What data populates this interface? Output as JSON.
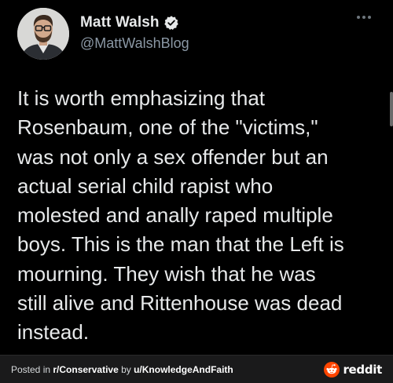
{
  "tweet": {
    "display_name": "Matt Walsh",
    "handle": "@MattWalshBlog",
    "text": "It is worth emphasizing that\nRosenbaum, one of the \"victims,\"\nwas not only a sex offender but an\nactual serial child rapist who\nmolested and anally raped multiple\nboys. This is the man that the Left is\nmourning. They wish that he was\nstill alive and Rittenhouse was dead\ninstead.",
    "verified_icon": "verified-badge-icon",
    "more_icon": "more-options-icon"
  },
  "footer": {
    "posted_in_prefix": "Posted in ",
    "subreddit": "r/Conservative",
    "by_text": " by ",
    "user": "u/KnowledgeAndFaith",
    "brand": "reddit",
    "brand_color": "#ff4500"
  }
}
